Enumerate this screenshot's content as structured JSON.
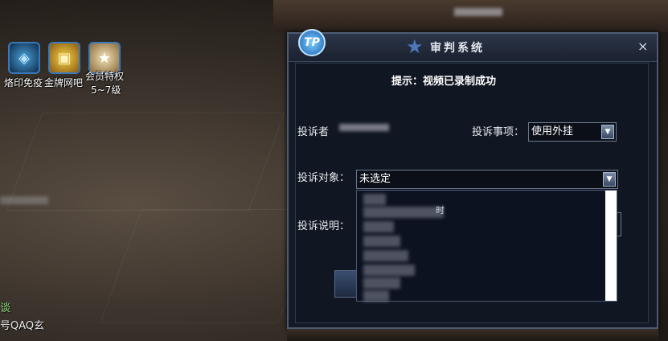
{
  "hud": {
    "buffs": [
      {
        "icon": "brand-icon",
        "label": "烙印免疫"
      },
      {
        "icon": "gold-card-icon",
        "label": "金牌网吧"
      },
      {
        "icon": "vip-star-icon",
        "label": "会员特权",
        "sublabel": "5~7级"
      }
    ],
    "chat_lines": [
      "谈",
      "号QAQ玄"
    ]
  },
  "dialog": {
    "logo_text": "TP",
    "title": "审判系统",
    "close_symbol": "×",
    "message": "提示：视频已录制成功",
    "complainant_label": "投诉者",
    "complaint_item_label": "投诉事项：",
    "complaint_item_value": "使用外挂",
    "target_label": "投诉对象：",
    "target_value": "未选定",
    "description_label": "投诉说明：",
    "dropdown_partial_text": "时"
  },
  "colors": {
    "accent": "#3a78b8",
    "dialog_bg": "#141a26",
    "chat_green": "#8fe07a"
  }
}
